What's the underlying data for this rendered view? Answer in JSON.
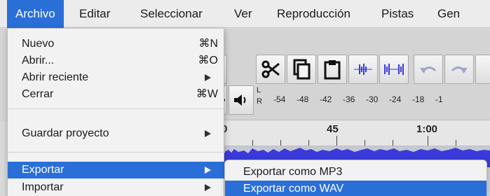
{
  "menubar": {
    "items": [
      {
        "label": "Archivo"
      },
      {
        "label": "Editar"
      },
      {
        "label": "Seleccionar"
      },
      {
        "label": "Ver"
      },
      {
        "label": "Reproducción"
      },
      {
        "label": "Pistas"
      },
      {
        "label": "Gen"
      }
    ],
    "active_index": 0
  },
  "file_menu": {
    "items": [
      {
        "label": "Nuevo",
        "shortcut": "⌘N"
      },
      {
        "label": "Abrir...",
        "shortcut": "⌘O"
      },
      {
        "label": "Abrir reciente",
        "has_submenu": true
      },
      {
        "label": "Cerrar",
        "shortcut": "⌘W"
      },
      {
        "label": "Guardar proyecto",
        "has_submenu": true
      },
      {
        "label": "Exportar",
        "has_submenu": true,
        "highlighted": true
      },
      {
        "label": "Importar",
        "has_submenu": true
      }
    ]
  },
  "export_submenu": {
    "items": [
      {
        "label": "Exportar como MP3"
      },
      {
        "label": "Exportar como WAV",
        "highlighted": true
      }
    ]
  },
  "meter": {
    "channel_top": "L",
    "channel_bottom": "R",
    "ticks": [
      "-54",
      "-48",
      "-42",
      "-36",
      "-30",
      "-24",
      "-18",
      "-1"
    ]
  },
  "ruler": {
    "labels": [
      "0",
      "45",
      "1:00"
    ]
  },
  "colors": {
    "highlight": "#2a6fd8",
    "menu_bg": "#f2f2f2",
    "menubar_bg": "#ececec",
    "waveform": "#3a3adb"
  },
  "icons": {
    "toolbar": [
      "draw-tool-icon",
      "multi-tool-icon",
      "speaker-icon",
      "cut-icon",
      "copy-icon",
      "paste-icon",
      "trim-icon",
      "silence-icon",
      "undo-icon",
      "redo-icon"
    ]
  }
}
